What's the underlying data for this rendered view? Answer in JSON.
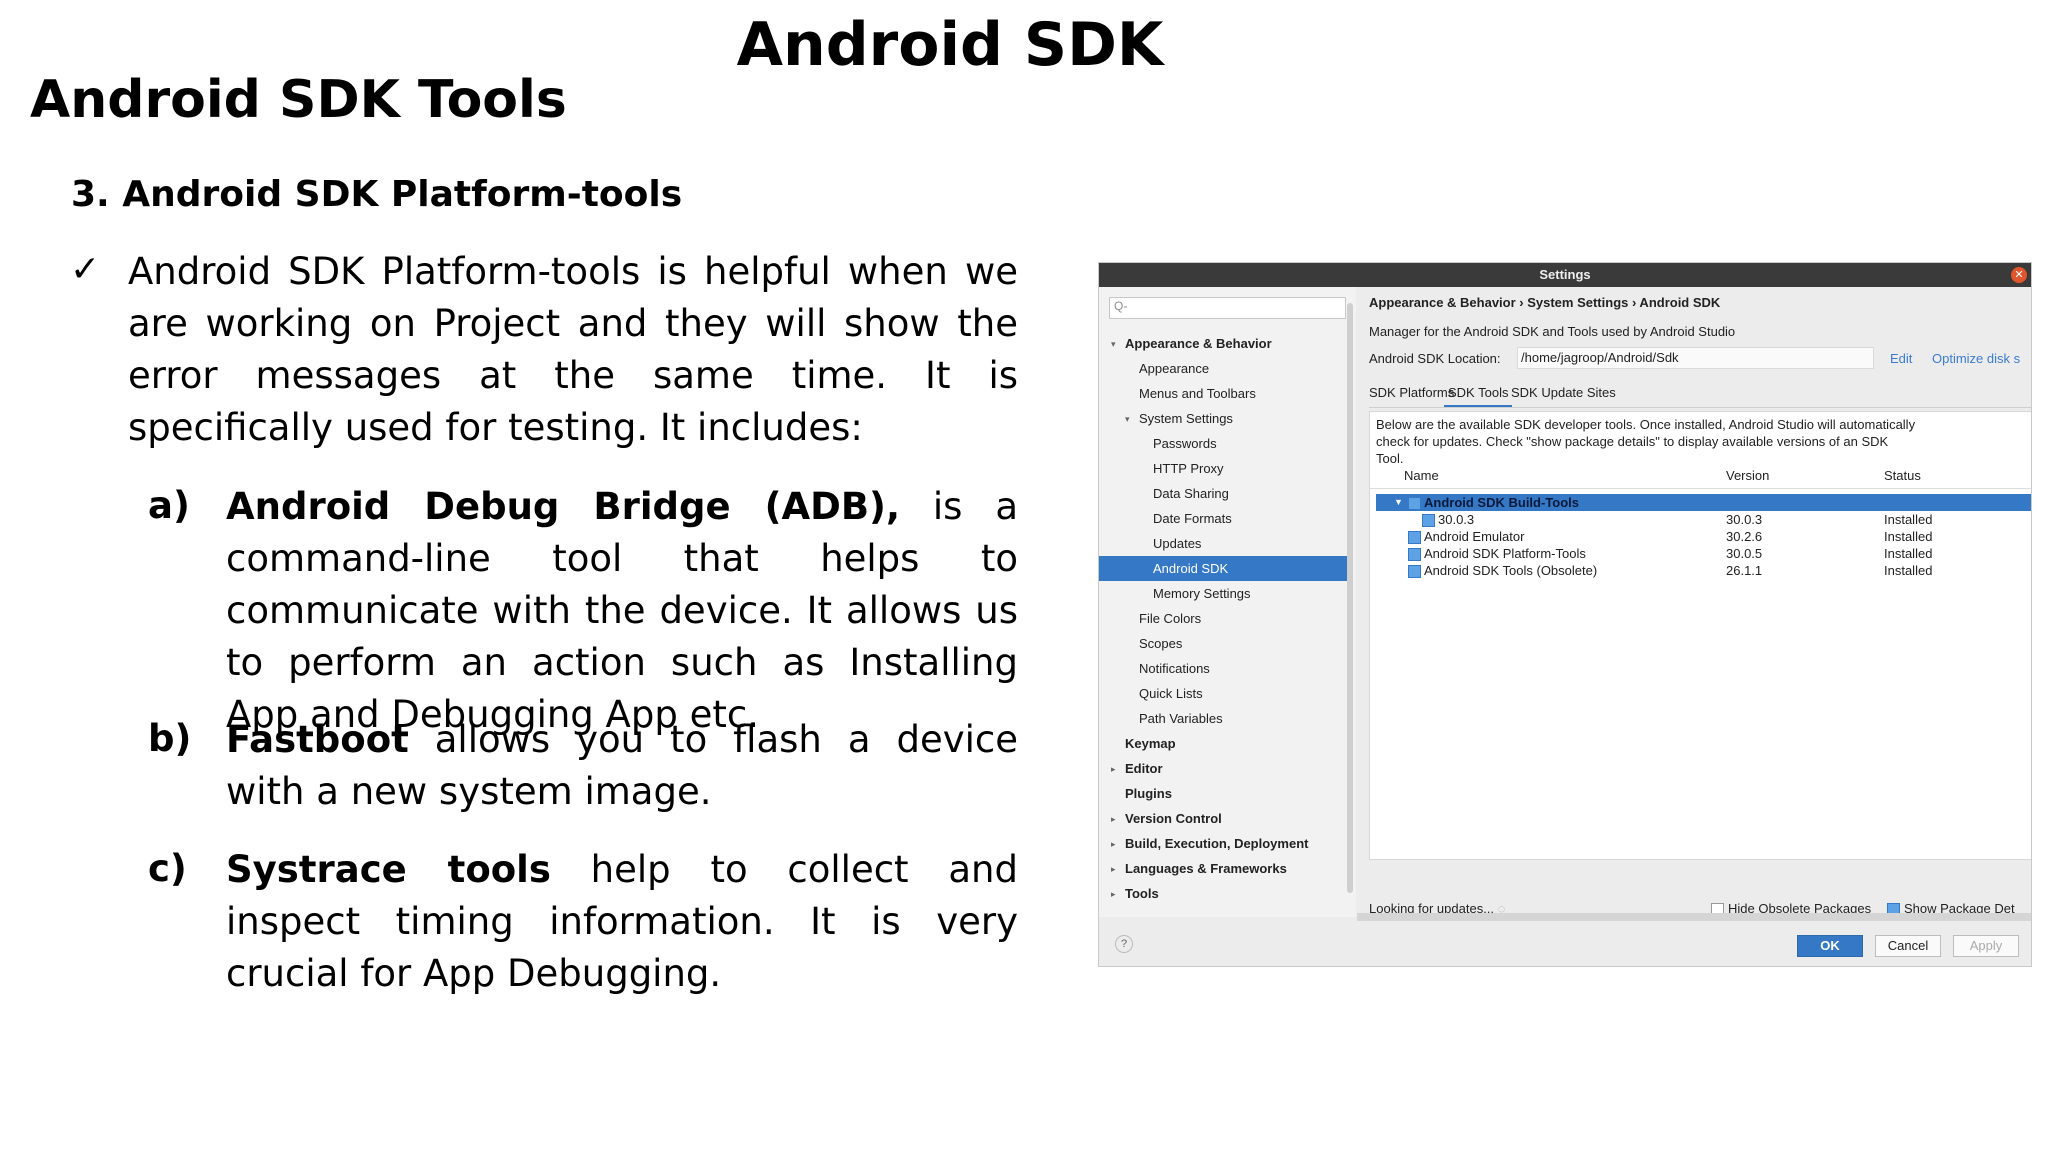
{
  "slide": {
    "title": "Android SDK",
    "section_title": "Android SDK Tools",
    "subsection": "3. Android SDK Platform-tools",
    "check_mark": "✓",
    "intro": "Android SDK Platform-tools is helpful when we are working on Project and they will show the error messages at the same time. It is specifically used for testing. It includes:",
    "items": [
      {
        "letter": "a)",
        "term": "Android Debug Bridge (ADB),",
        "text": " is a command-line tool that helps to communicate with the device. It allows us to perform an action such as Installing App and Debugging App etc."
      },
      {
        "letter": "b)",
        "term": "Fastboot",
        "text": " allows you to flash a device with a new system image."
      },
      {
        "letter": "c)",
        "term": "Systrace tools",
        "text": " help to collect and inspect timing information. It is very crucial for App Debugging."
      }
    ]
  },
  "settings": {
    "window_title": "Settings",
    "search_placeholder": "Q-",
    "sidebar": [
      {
        "label": "Appearance & Behavior",
        "level": 0,
        "bold": true,
        "arrow": "▾"
      },
      {
        "label": "Appearance",
        "level": 1
      },
      {
        "label": "Menus and Toolbars",
        "level": 1
      },
      {
        "label": "System Settings",
        "level": 1,
        "arrow": "▾"
      },
      {
        "label": "Passwords",
        "level": 2
      },
      {
        "label": "HTTP Proxy",
        "level": 2
      },
      {
        "label": "Data Sharing",
        "level": 2
      },
      {
        "label": "Date Formats",
        "level": 2
      },
      {
        "label": "Updates",
        "level": 2
      },
      {
        "label": "Android SDK",
        "level": 2,
        "selected": true
      },
      {
        "label": "Memory Settings",
        "level": 2
      },
      {
        "label": "File Colors",
        "level": 1
      },
      {
        "label": "Scopes",
        "level": 1
      },
      {
        "label": "Notifications",
        "level": 1
      },
      {
        "label": "Quick Lists",
        "level": 1
      },
      {
        "label": "Path Variables",
        "level": 1
      },
      {
        "label": "Keymap",
        "level": 0,
        "bold": true
      },
      {
        "label": "Editor",
        "level": 0,
        "bold": true,
        "arrow": "▸"
      },
      {
        "label": "Plugins",
        "level": 0,
        "bold": true
      },
      {
        "label": "Version Control",
        "level": 0,
        "bold": true,
        "arrow": "▸"
      },
      {
        "label": "Build, Execution, Deployment",
        "level": 0,
        "bold": true,
        "arrow": "▸"
      },
      {
        "label": "Languages & Frameworks",
        "level": 0,
        "bold": true,
        "arrow": "▸"
      },
      {
        "label": "Tools",
        "level": 0,
        "bold": true,
        "arrow": "▸"
      }
    ],
    "breadcrumb": "Appearance & Behavior  ›  System Settings  ›  Android SDK",
    "description": "Manager for the Android SDK and Tools used by Android Studio",
    "location_label": "Android SDK Location:",
    "location_value": "/home/jagroop/Android/Sdk",
    "edit_link": "Edit",
    "optimize_link": "Optimize disk s",
    "tabs": [
      "SDK Platforms",
      "SDK Tools",
      "SDK Update Sites"
    ],
    "info_text": "Below are the available SDK developer tools. Once installed, Android Studio will automatically check for updates. Check \"show package details\" to display available versions of an SDK Tool.",
    "columns": [
      "Name",
      "Version",
      "Status"
    ],
    "rows": [
      {
        "name": "Android SDK Build-Tools",
        "version": "",
        "status": "",
        "selected": true
      },
      {
        "name": "30.0.3",
        "version": "30.0.3",
        "status": "Installed",
        "indent": true
      },
      {
        "name": "Android Emulator",
        "version": "30.2.6",
        "status": "Installed"
      },
      {
        "name": "Android SDK Platform-Tools",
        "version": "30.0.5",
        "status": "Installed"
      },
      {
        "name": "Android SDK Tools (Obsolete)",
        "version": "26.1.1",
        "status": "Installed"
      }
    ],
    "looking_text": "Looking for updates...",
    "hide_obsolete": "Hide Obsolete Packages",
    "show_details": "Show Package Det",
    "help": "?",
    "ok": "OK",
    "cancel": "Cancel",
    "apply": "Apply"
  }
}
